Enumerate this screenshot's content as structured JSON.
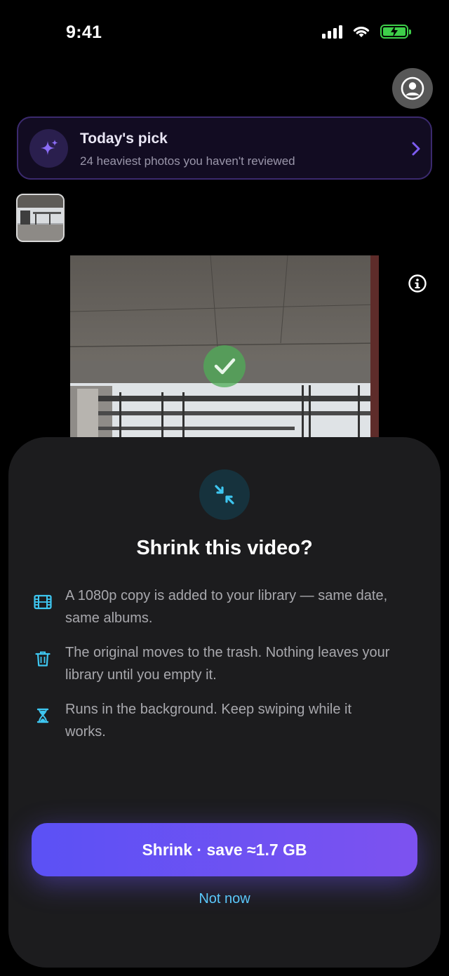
{
  "status_bar": {
    "time": "9:41"
  },
  "todays_pick": {
    "title": "Today's pick",
    "subtitle": "24 heaviest photos you haven't reviewed"
  },
  "sheet": {
    "title": "Shrink this video?",
    "items": [
      {
        "icon": "film-icon",
        "text": "A 1080p copy is added to your library — same date, same albums."
      },
      {
        "icon": "trash-icon",
        "text": "The original moves to the trash. Nothing leaves your library until you empty it."
      },
      {
        "icon": "hourglass-icon",
        "text": "Runs in the background. Keep swiping while it works."
      }
    ],
    "primary_button": "Shrink · save ≈1.7 GB",
    "secondary_button": "Not now"
  },
  "colors": {
    "accent_purple": "#6a52f5",
    "accent_cyan": "#5ac8fa",
    "battery_green": "#3ecf4a"
  }
}
